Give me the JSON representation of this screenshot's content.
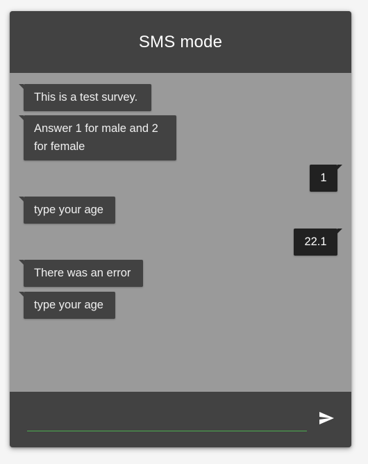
{
  "header": {
    "title": "SMS mode"
  },
  "messages": [
    {
      "direction": "in",
      "text": "This is a test survey."
    },
    {
      "direction": "in",
      "text": "Answer 1 for male and 2 for female"
    },
    {
      "direction": "out",
      "text": "1"
    },
    {
      "direction": "in",
      "text": "type your age"
    },
    {
      "direction": "out",
      "text": "22.1"
    },
    {
      "direction": "in",
      "text": "There was an error"
    },
    {
      "direction": "in",
      "text": "type your age"
    }
  ],
  "composer": {
    "value": "",
    "send_icon": "send-icon"
  },
  "colors": {
    "header": "#424242",
    "background": "#9a9a9a",
    "incoming_bubble": "#424242",
    "outgoing_bubble": "#212121",
    "input_underline": "#4caf50"
  }
}
